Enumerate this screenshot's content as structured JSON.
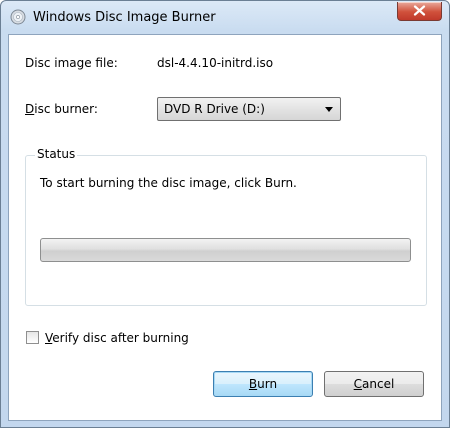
{
  "window": {
    "title": "Windows Disc Image Burner"
  },
  "fields": {
    "disc_image_file_label": "Disc image file:",
    "disc_image_file_value": "dsl-4.4.10-initrd.iso",
    "disc_burner_label_key": "D",
    "disc_burner_label_rest": "isc burner:",
    "disc_burner_selected": "DVD R Drive (D:)"
  },
  "status": {
    "group_title": "Status",
    "message": "To start burning the disc image, click Burn.",
    "progress": 0
  },
  "verify": {
    "label_key": "V",
    "label_rest": "erify disc after burning",
    "checked": false
  },
  "buttons": {
    "burn_key": "B",
    "burn_rest": "urn",
    "cancel_key": "C",
    "cancel_rest": "ancel"
  },
  "colors": {
    "frame": "#c3d7ee",
    "close_button": "#c0392b",
    "default_button_border": "#3c7fb1",
    "group_border": "#d5dfe5"
  },
  "icons": [
    "disc-app-icon",
    "close-icon",
    "dropdown-arrow-icon"
  ]
}
